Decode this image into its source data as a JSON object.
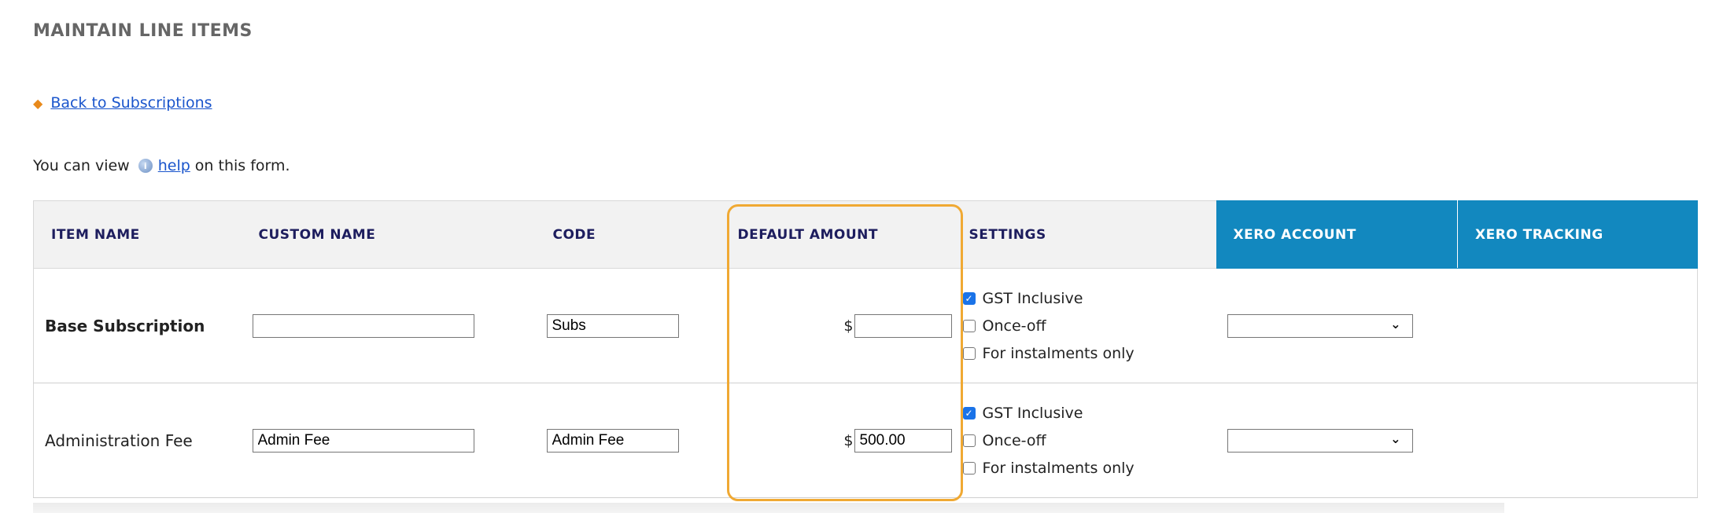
{
  "page": {
    "title": "MAINTAIN LINE ITEMS",
    "back_link": "Back to Subscriptions",
    "help_prefix": "You can view",
    "help_link": "help",
    "help_suffix": "on this form."
  },
  "icons": {
    "back": "back-arrow-icon",
    "help": "info-icon",
    "checkbox": "checkmark-icon",
    "select": "chevron-down-icon"
  },
  "colors": {
    "xero_header": "#1288bf",
    "highlight": "#f0a933",
    "link": "#1a55cc",
    "checkbox_on": "#1a73e8"
  },
  "table": {
    "headers": [
      "ITEM NAME",
      "CUSTOM NAME",
      "CODE",
      "DEFAULT AMOUNT",
      "SETTINGS",
      "XERO ACCOUNT",
      "XERO TRACKING"
    ],
    "rows": [
      {
        "item_name": "Base Subscription",
        "custom_name": "",
        "code": "Subs",
        "currency": "$",
        "amount": "",
        "settings": [
          {
            "label": "GST Inclusive",
            "checked": true
          },
          {
            "label": "Once-off",
            "checked": false
          },
          {
            "label": "For instalments only",
            "checked": false
          }
        ],
        "xero_account": ""
      },
      {
        "item_name": "Administration Fee",
        "custom_name": "Admin Fee",
        "code": "Admin Fee",
        "currency": "$",
        "amount": "500.00",
        "settings": [
          {
            "label": "GST Inclusive",
            "checked": true
          },
          {
            "label": "Once-off",
            "checked": false
          },
          {
            "label": "For instalments only",
            "checked": false
          }
        ],
        "xero_account": ""
      }
    ]
  }
}
